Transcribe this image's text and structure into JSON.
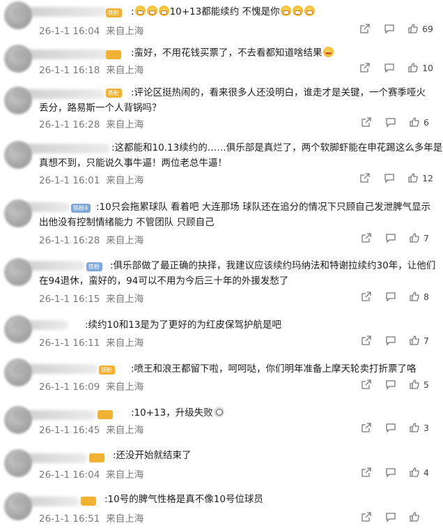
{
  "comments": [
    {
      "badge": "铁粉",
      "badge_color": "gold",
      "text_lines": [
        ":",
        "10+13都能续约 不愧是你"
      ],
      "time": "26-1-1 16:04",
      "location": "来自上海",
      "likes": "69"
    },
    {
      "badge": "",
      "badge_color": "gold",
      "text_lines": [
        ":蛮好，不用花钱买票了，不去看都知道啥结果"
      ],
      "time": "26-1-1 16:18",
      "location": "来自上海",
      "likes": "10"
    },
    {
      "badge": "铁粉",
      "badge_color": "gold",
      "text_lines": [
        ":评论区挺热闹的，看来很多人还没明白，谁走才是关键，一个赛季哑火",
        "丢分，路易斯一个人背锅吗？"
      ],
      "time": "26-1-1 16:28",
      "location": "来自上海",
      "likes": "6"
    },
    {
      "badge": "",
      "badge_color": "gold",
      "text_lines": [
        ":这都能和10.13续约的……俱乐部是真烂了，两个软脚虾能在申花踢这么多年是",
        "真想不到，只能说久事牛逼！两位老总牛逼！"
      ],
      "time": "26-1-1 16:01",
      "location": "来自上海",
      "likes": "12"
    },
    {
      "badge": "铁粉4",
      "badge_color": "blue",
      "text_lines": [
        ":10只会拖累球队 看着吧 大连那场 球队还在追分的情况下只顾自己发泄脾气显示",
        "出他没有控制情绪能力 不管团队 只顾自己"
      ],
      "time": "26-1-1 16:28",
      "location": "来自上海",
      "likes": "7"
    },
    {
      "badge": "铁粉",
      "badge_color": "blue",
      "text_lines": [
        ":俱乐部做了最正确的抉择，我建议应该续约玛纳法和特谢拉续约30年，让他们",
        "在94退休，蛮好的，94可以不用为今后三十年的外援发愁了"
      ],
      "time": "26-1-1 16:15",
      "location": "来自上海",
      "likes": "8"
    },
    {
      "badge": "",
      "badge_color": "gold",
      "text_lines": [
        ":续约10和13是为了更好的为红皮保驾护航是吧"
      ],
      "time": "26-1-1 16:11",
      "location": "来自上海",
      "likes": "7"
    },
    {
      "badge": "铁粉",
      "badge_color": "gold",
      "text_lines": [
        ":喷王和浪王都留下啦，呵呵哒，你们明年准备上摩天轮卖打折票了咯"
      ],
      "time": "26-1-1 16:09",
      "location": "来自上海",
      "likes": "5"
    },
    {
      "badge": "",
      "badge_color": "gold",
      "text_lines": [
        ":10+13，升级失败"
      ],
      "time": "26-1-1 16:45",
      "location": "来自上海",
      "likes": "3"
    },
    {
      "badge": "",
      "badge_color": "gold",
      "text_lines": [
        ":还没开始就结束了"
      ],
      "time": "26-1-1 16:04",
      "location": "来自上海",
      "likes": "4"
    },
    {
      "badge": "",
      "badge_color": "gold",
      "text_lines": [
        ":10号的脾气性格是真不像10号位球员"
      ],
      "time": "26-1-1 16:51",
      "location": "来自上海",
      "likes": ""
    }
  ],
  "icons": {
    "share": "share-icon",
    "comment": "comment-icon",
    "like": "thumbs-up-icon"
  }
}
